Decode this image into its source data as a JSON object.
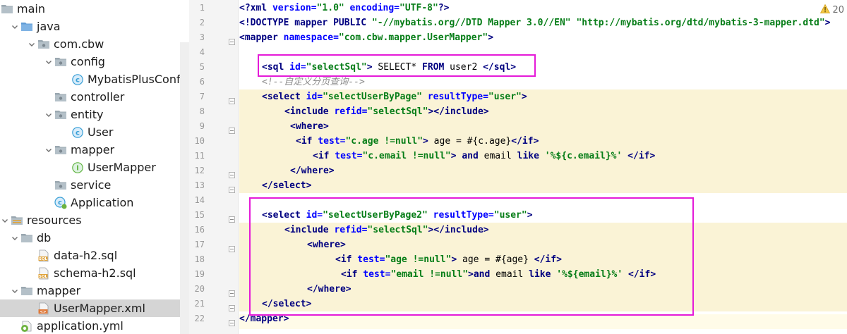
{
  "tree": {
    "items": [
      {
        "label": "main",
        "level": 0,
        "arrow": "none",
        "icon": "folder-icon"
      },
      {
        "label": "java",
        "level": 1,
        "arrow": "down",
        "icon": "source-folder-icon"
      },
      {
        "label": "com.cbw",
        "level": 2,
        "arrow": "down",
        "icon": "package-icon"
      },
      {
        "label": "config",
        "level": 3,
        "arrow": "down",
        "icon": "package-icon"
      },
      {
        "label": "MybatisPlusConfig",
        "level": 4,
        "arrow": "none",
        "icon": "class-icon"
      },
      {
        "label": "controller",
        "level": 3,
        "arrow": "none",
        "icon": "package-icon"
      },
      {
        "label": "entity",
        "level": 3,
        "arrow": "down",
        "icon": "package-icon"
      },
      {
        "label": "User",
        "level": 4,
        "arrow": "none",
        "icon": "class-icon"
      },
      {
        "label": "mapper",
        "level": 3,
        "arrow": "down",
        "icon": "package-icon"
      },
      {
        "label": "UserMapper",
        "level": 4,
        "arrow": "none",
        "icon": "interface-icon"
      },
      {
        "label": "service",
        "level": 3,
        "arrow": "none",
        "icon": "package-icon"
      },
      {
        "label": "Application",
        "level": 3,
        "arrow": "none",
        "icon": "spring-class-icon"
      },
      {
        "label": "resources",
        "level": 0,
        "arrow": "down",
        "icon": "resources-folder-icon"
      },
      {
        "label": "db",
        "level": 1,
        "arrow": "down",
        "icon": "folder-icon"
      },
      {
        "label": "data-h2.sql",
        "level": 2,
        "arrow": "none",
        "icon": "sql-file-icon"
      },
      {
        "label": "schema-h2.sql",
        "level": 2,
        "arrow": "none",
        "icon": "sql-file-icon"
      },
      {
        "label": "mapper",
        "level": 1,
        "arrow": "down",
        "icon": "folder-icon"
      },
      {
        "label": "UserMapper.xml",
        "level": 2,
        "arrow": "none",
        "icon": "xml-file-icon",
        "selected": true
      },
      {
        "label": "application.yml",
        "level": 1,
        "arrow": "none",
        "icon": "yml-file-icon"
      }
    ]
  },
  "editor": {
    "warning_count": "20",
    "line_numbers": [
      "1",
      "2",
      "3",
      "4",
      "5",
      "6",
      "7",
      "8",
      "9",
      "10",
      "11",
      "12",
      "13",
      "14",
      "15",
      "16",
      "17",
      "18",
      "19",
      "20",
      "21",
      "22"
    ],
    "lines": [
      "<?xml version=\"1.0\" encoding=\"UTF-8\"?>",
      "<!DOCTYPE mapper PUBLIC \"-//mybatis.org//DTD Mapper 3.0//EN\" \"http://mybatis.org/dtd/mybatis-3-mapper.dtd\">",
      "<mapper namespace=\"com.cbw.mapper.UserMapper\">",
      "",
      "<sql id=\"selectSql\"> SELECT* FROM user2 </sql>",
      "<!--自定义分页查询-->",
      "<select id=\"selectUserByPage\" resultType=\"user\">",
      "<include refid=\"selectSql\"></include>",
      "<where>",
      "<if test=\"c.age !=null\"> age = #{c.age}</if>",
      "<if test=\"c.email !=null\"> and email like '%${c.email}%' </if>",
      "</where>",
      "</select>",
      "",
      "<select id=\"selectUserByPage2\" resultType=\"user\">",
      "<include refid=\"selectSql\"></include>",
      "<where>",
      "<if test=\"age !=null\"> age = #{age} </if>",
      "<if test=\"email !=null\">and email like '%${email}%' </if>",
      "</where>",
      "</select>",
      "</mapper>"
    ]
  },
  "colors": {
    "highlight_box": "#e51ad8",
    "tag": "#000080",
    "attribute": "#0000ff",
    "string": "#067d17",
    "comment": "#8c8c8c",
    "block_highlight": "#faf3d6"
  }
}
